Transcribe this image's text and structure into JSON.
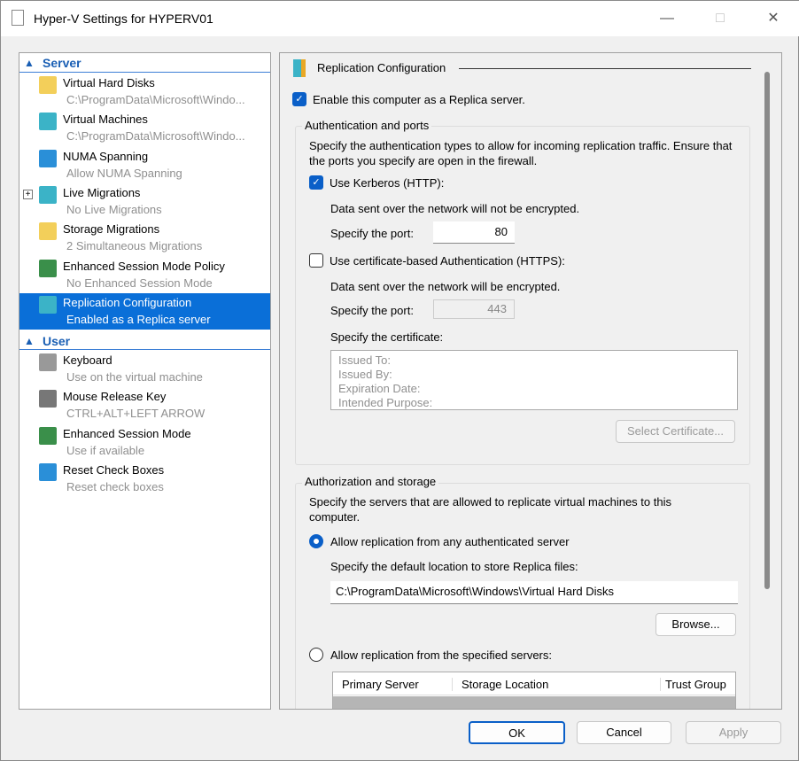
{
  "window": {
    "title": "Hyper-V Settings for HYPERV01"
  },
  "tree": {
    "server_label": "Server",
    "user_label": "User",
    "server_items": [
      {
        "title": "Virtual Hard Disks",
        "sub": "C:\\ProgramData\\Microsoft\\Windo...",
        "icon": "hard-disk-folder-icon"
      },
      {
        "title": "Virtual Machines",
        "sub": "C:\\ProgramData\\Microsoft\\Windo...",
        "icon": "vm-folder-icon"
      },
      {
        "title": "NUMA Spanning",
        "sub": "Allow NUMA Spanning",
        "icon": "monitor-icon"
      },
      {
        "title": "Live Migrations",
        "sub": "No Live Migrations",
        "icon": "server-migration-icon"
      },
      {
        "title": "Storage Migrations",
        "sub": "2 Simultaneous Migrations",
        "icon": "storage-migration-icon"
      },
      {
        "title": "Enhanced Session Mode Policy",
        "sub": "No Enhanced Session Mode",
        "icon": "session-policy-icon"
      },
      {
        "title": "Replication Configuration",
        "sub": "Enabled as a Replica server",
        "icon": "replication-icon"
      }
    ],
    "user_items": [
      {
        "title": "Keyboard",
        "sub": "Use on the virtual machine",
        "icon": "keyboard-icon"
      },
      {
        "title": "Mouse Release Key",
        "sub": "CTRL+ALT+LEFT ARROW",
        "icon": "mouse-key-icon"
      },
      {
        "title": "Enhanced Session Mode",
        "sub": "Use if available",
        "icon": "session-icon"
      },
      {
        "title": "Reset Check Boxes",
        "sub": "Reset check boxes",
        "icon": "reset-checkbox-icon"
      }
    ]
  },
  "panel": {
    "heading": "Replication Configuration",
    "enable_label": "Enable this computer as a Replica server.",
    "auth": {
      "title": "Authentication and ports",
      "desc": "Specify the authentication types to allow for incoming replication traffic. Ensure that the ports you specify are open in the firewall.",
      "kerberos_label": "Use Kerberos (HTTP):",
      "kerberos_note": "Data sent over the network will not be encrypted.",
      "port_label": "Specify the port:",
      "kerberos_port": "80",
      "cert_label": "Use certificate-based Authentication (HTTPS):",
      "cert_note": "Data sent over the network will be encrypted.",
      "cert_port": "443",
      "cert_spec_label": "Specify the certificate:",
      "cert_fields": [
        "Issued To:",
        "Issued By:",
        "Expiration Date:",
        "Intended Purpose:"
      ],
      "select_cert": "Select Certificate..."
    },
    "storage": {
      "title": "Authorization and storage",
      "desc": "Specify the servers that are allowed to replicate virtual machines to this computer.",
      "any_label": "Allow replication from any authenticated server",
      "loc_label": "Specify the default location to store Replica files:",
      "location": "C:\\ProgramData\\Microsoft\\Windows\\Virtual Hard Disks",
      "browse": "Browse...",
      "specified_label": "Allow replication from the specified servers:",
      "columns": [
        "Primary Server",
        "Storage Location",
        "Trust Group"
      ]
    }
  },
  "buttons": {
    "ok": "OK",
    "cancel": "Cancel",
    "apply": "Apply"
  }
}
